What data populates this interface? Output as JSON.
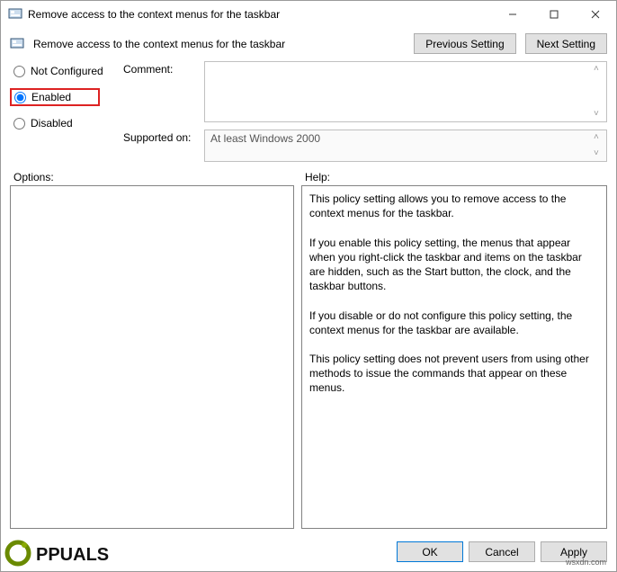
{
  "window": {
    "title": "Remove access to the context menus for the taskbar"
  },
  "header": {
    "title": "Remove access to the context menus for the taskbar",
    "previous_setting": "Previous Setting",
    "next_setting": "Next Setting"
  },
  "radios": {
    "not_configured": "Not Configured",
    "enabled": "Enabled",
    "disabled": "Disabled",
    "selected": "enabled"
  },
  "comment": {
    "label": "Comment:",
    "value": ""
  },
  "supported": {
    "label": "Supported on:",
    "value": "At least Windows 2000"
  },
  "sections": {
    "options_label": "Options:",
    "help_label": "Help:"
  },
  "options_text": "",
  "help_text": "This policy setting allows you to remove access to the context menus for the taskbar.\n\nIf you enable this policy setting, the menus that appear when you right-click the taskbar and items on the taskbar are hidden, such as the Start button, the clock, and the taskbar buttons.\n\nIf you disable or do not configure this policy setting, the context menus for the taskbar are available.\n\nThis policy setting does not prevent users from using other methods to issue the commands that appear on these menus.",
  "footer": {
    "ok": "OK",
    "cancel": "Cancel",
    "apply": "Apply"
  },
  "watermark": "wsxdn.com",
  "logo_text": "APPUALS"
}
